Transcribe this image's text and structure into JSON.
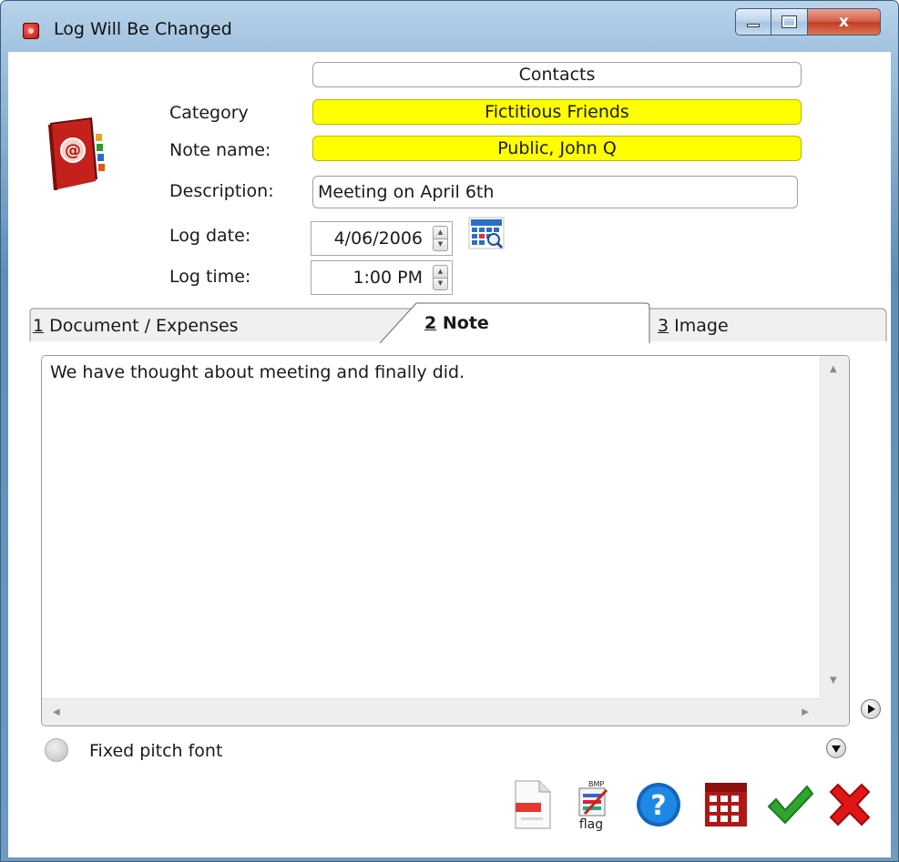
{
  "window": {
    "title": "Log Will Be Changed",
    "close_glyph": "x"
  },
  "form": {
    "table_name": "Contacts",
    "category_label": "Category",
    "category_value": "Fictitious Friends",
    "note_name_label": "Note name:",
    "note_name_value": "Public, John Q",
    "description_label": "Description:",
    "description_value": "Meeting on April 6th",
    "log_date_label": "Log date:",
    "log_date_value": "4/06/2006",
    "log_time_label": "Log time:",
    "log_time_value": "1:00 PM"
  },
  "tabs": [
    {
      "number": "1",
      "label": "Document / Expenses"
    },
    {
      "number": "2",
      "label": "Note"
    },
    {
      "number": "3",
      "label": "Image"
    }
  ],
  "note": {
    "text": "We have thought about meeting and finally did."
  },
  "options": {
    "fixed_pitch_label": "Fixed pitch font"
  },
  "toolbar": {
    "bmp_caption": "BMP",
    "bmp_sub": "flag"
  },
  "colors": {
    "required_field": "#ffff00",
    "titlebar": "#9fc1df",
    "close_button": "#c23b22",
    "ok_green": "#2fa52f",
    "cancel_red": "#e01515",
    "help_blue": "#1565c0"
  },
  "icons": {
    "app": "address-book-icon",
    "calendar": "calendar-icon",
    "new_doc": "document-icon",
    "bmp": "bitmap-icon",
    "help": "help-icon",
    "table": "table-icon",
    "ok": "checkmark-icon",
    "cancel": "cancel-x-icon"
  }
}
